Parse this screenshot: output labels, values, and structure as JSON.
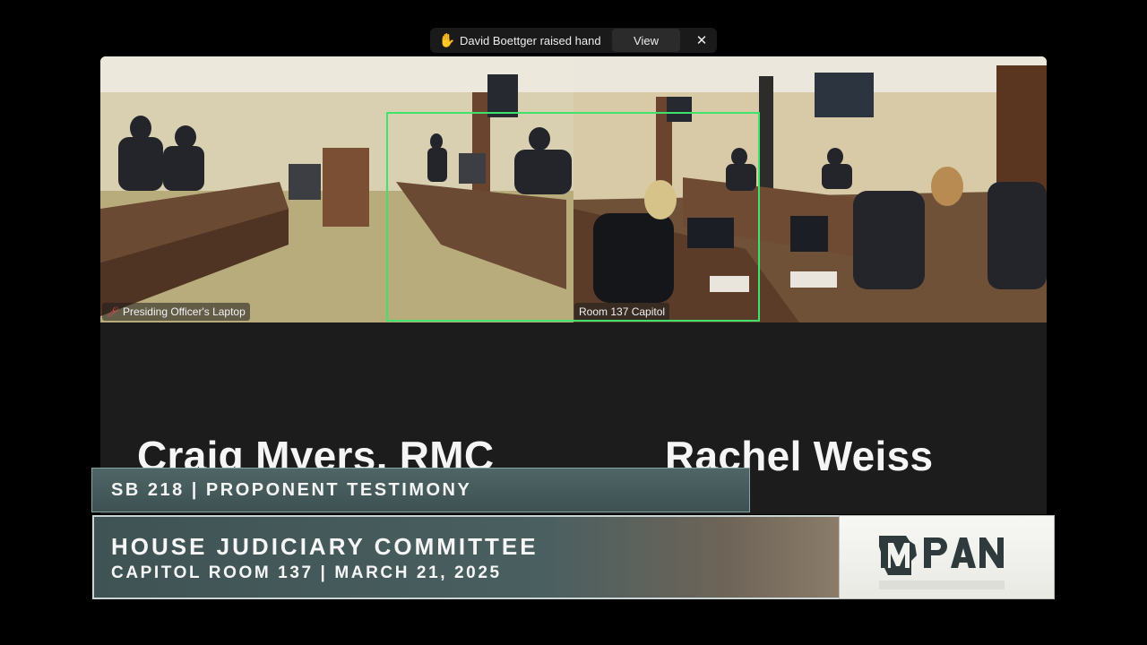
{
  "notification": {
    "icon": "raised-hand-icon",
    "text": "David Boettger raised hand",
    "view_label": "View",
    "close_glyph": "✕"
  },
  "video": {
    "left_tile_label": "Presiding Officer's Laptop",
    "right_tile_label": "Room 137 Capitol",
    "highlight_color": "#3fe36b"
  },
  "speakers": {
    "left": "Craig Myers, RMC",
    "right": "Rachel Weiss"
  },
  "lower_third": {
    "bill_line": "SB 218 | PROPONENT TESTIMONY",
    "committee": "HOUSE JUDICIARY COMMITTEE",
    "location_date": "CAPITOL ROOM 137 | MARCH 21, 2025",
    "logo_text": "MPAN"
  },
  "colors": {
    "banner": "#4a5f60",
    "accent_green": "#3fe36b"
  }
}
